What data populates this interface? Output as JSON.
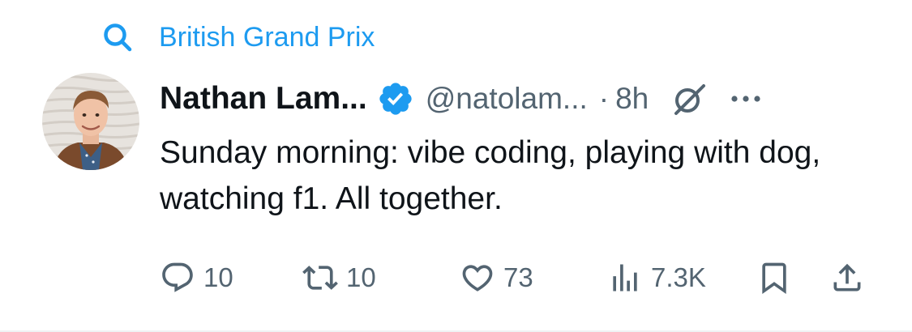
{
  "colors": {
    "accent": "#1d9bf0",
    "text_primary": "#0f1419",
    "text_secondary": "#536471",
    "divider": "#eff3f4"
  },
  "context": {
    "icon": "search-icon",
    "label": "British Grand Prix"
  },
  "tweet": {
    "author": {
      "display_name": "Nathan Lam...",
      "handle": "@natolam...",
      "verified": true,
      "verified_icon": "verified-badge-icon",
      "avatar": "avatar"
    },
    "separator": "·",
    "timestamp": "8h",
    "grok_icon": "grok-icon",
    "more_icon": "more-icon",
    "text": "Sunday morning: vibe coding, playing with dog, watching f1. All together."
  },
  "actions": {
    "reply": {
      "icon": "reply-icon",
      "count": "10"
    },
    "repost": {
      "icon": "repost-icon",
      "count": "10"
    },
    "like": {
      "icon": "like-icon",
      "count": "73"
    },
    "views": {
      "icon": "views-icon",
      "count": "7.3K"
    },
    "bookmark": {
      "icon": "bookmark-icon"
    },
    "share": {
      "icon": "share-icon"
    }
  }
}
